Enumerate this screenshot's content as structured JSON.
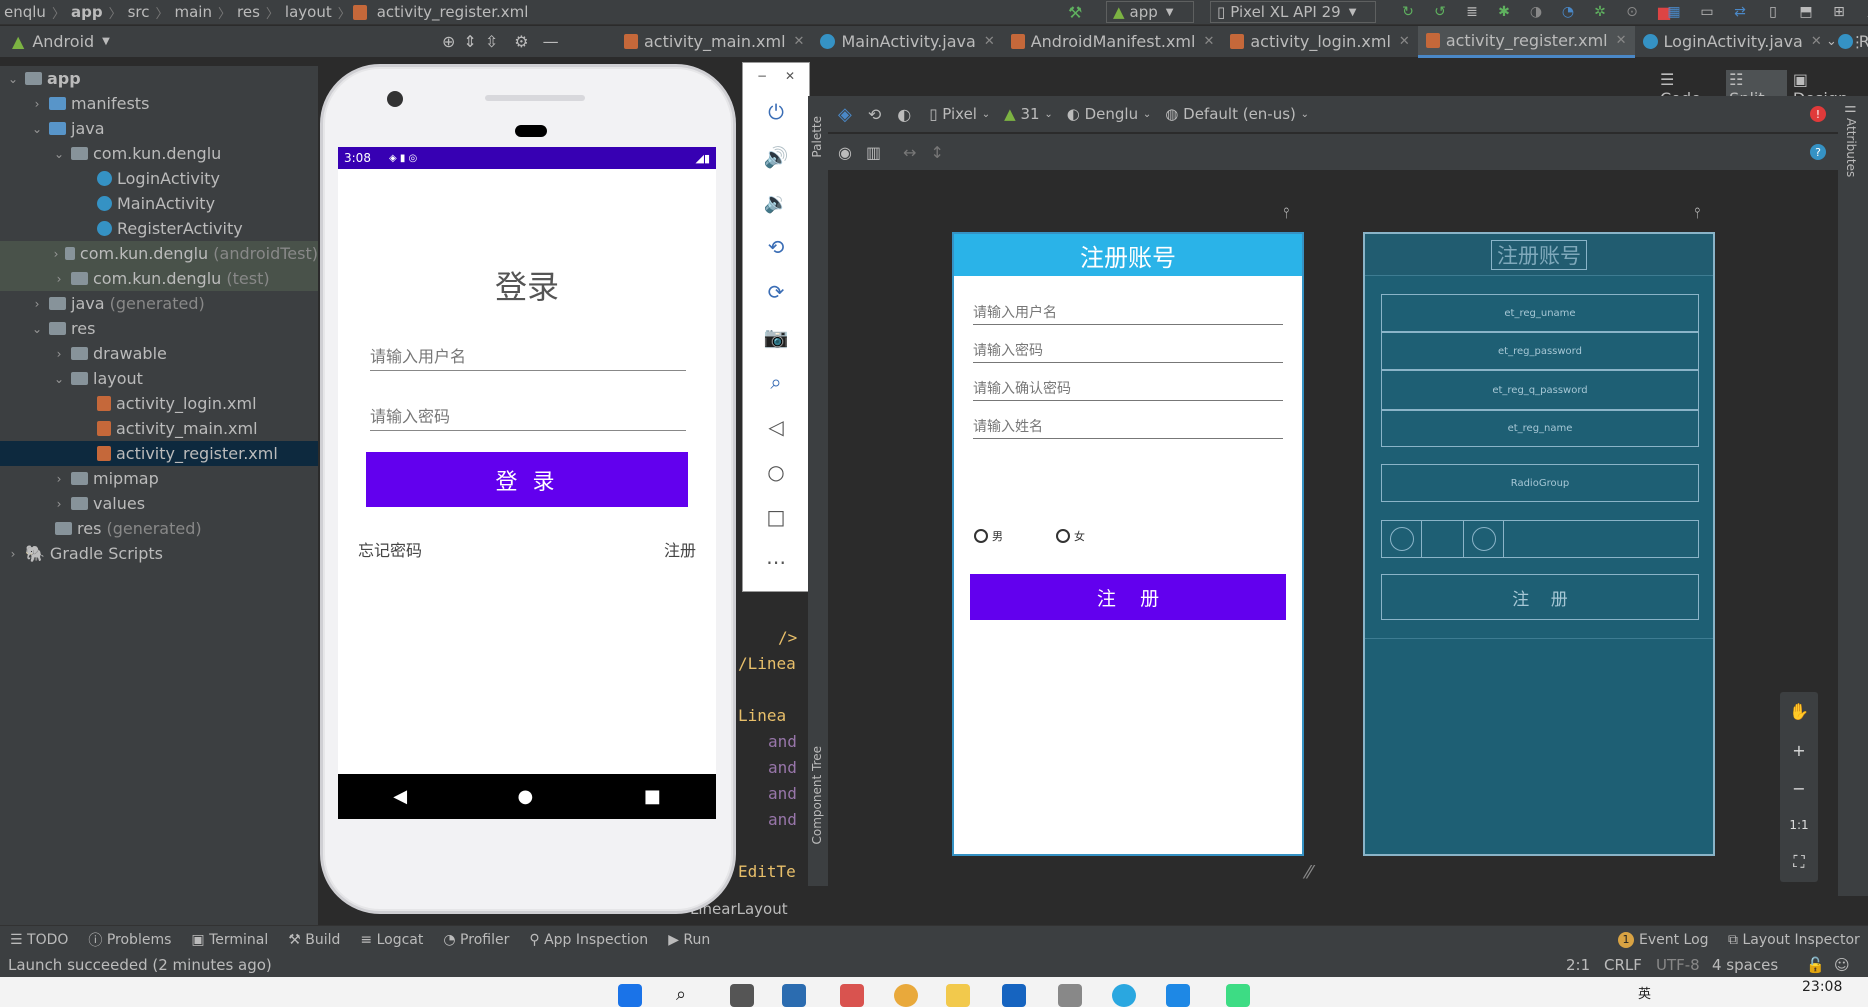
{
  "nav": {
    "breadcrumbs": [
      "enqlu",
      "app",
      "src",
      "main",
      "res",
      "layout",
      "activity_register.xml"
    ],
    "run_config": "app",
    "device": "Pixel XL API 29"
  },
  "tabs": {
    "project_view": "Android",
    "files": [
      {
        "label": "activity_main.xml",
        "type": "xml"
      },
      {
        "label": "MainActivity.java",
        "type": "java"
      },
      {
        "label": "AndroidManifest.xml",
        "type": "xml"
      },
      {
        "label": "activity_login.xml",
        "type": "xml"
      },
      {
        "label": "activity_register.xml",
        "type": "xml"
      },
      {
        "label": "LoginActivity.java",
        "type": "java"
      },
      {
        "label": "R",
        "type": "java"
      }
    ]
  },
  "view_modes": {
    "code": "Code",
    "split": "Split",
    "design": "Design"
  },
  "tree": [
    {
      "label": "app",
      "bold": true
    },
    {
      "label": "manifests"
    },
    {
      "label": "java"
    },
    {
      "label": "com.kun.denglu"
    },
    {
      "label": "LoginActivity"
    },
    {
      "label": "MainActivity"
    },
    {
      "label": "RegisterActivity"
    },
    {
      "label": "com.kun.denglu",
      "suffix": "(androidTest)"
    },
    {
      "label": "com.kun.denglu",
      "suffix": "(test)"
    },
    {
      "label": "java",
      "suffix": "(generated)"
    },
    {
      "label": "res"
    },
    {
      "label": "drawable"
    },
    {
      "label": "layout"
    },
    {
      "label": "activity_login.xml"
    },
    {
      "label": "activity_main.xml"
    },
    {
      "label": "activity_register.xml"
    },
    {
      "label": "mipmap"
    },
    {
      "label": "values"
    },
    {
      "label": "res",
      "suffix": "(generated)"
    },
    {
      "label": "Gradle Scripts"
    }
  ],
  "emulator": {
    "time": "3:08",
    "login_title": "登录",
    "username_hint": "请输入用户名",
    "password_hint": "请输入密码",
    "login_button": "登 录",
    "forgot": "忘记密码",
    "register": "注册"
  },
  "design_toolbar": {
    "device": "Pixel",
    "api": "31",
    "theme": "Denglu",
    "locale": "Default (en-us)",
    "palette": "Palette",
    "component_tree": "Component Tree"
  },
  "preview": {
    "title": "注册账号",
    "hints": [
      "请输入用户名",
      "请输入密码",
      "请输入确认密码",
      "请输入姓名"
    ],
    "radio_male": "男",
    "radio_female": "女",
    "button": "注    册"
  },
  "blueprint": {
    "title": "注册账号",
    "ids": [
      "et_reg_uname",
      "et_reg_password",
      "et_reg_q_password",
      "et_reg_name"
    ],
    "radiogroup": "RadioGroup",
    "button": "注    册"
  },
  "editor_code": [
    "/>",
    "/Linea",
    "Linea",
    "and",
    "and",
    "and",
    "and",
    "EditTe"
  ],
  "editor_breadcrumb": "LinearLayout",
  "attributes_label": "Attributes",
  "zoom": {
    "one_to_one": "1:1"
  },
  "bottom_tools": [
    "TODO",
    "Problems",
    "Terminal",
    "Build",
    "Logcat",
    "Profiler",
    "App Inspection",
    "Run"
  ],
  "right_tools": {
    "event_log": "Event Log",
    "event_count": "1",
    "layout_inspector": "Layout Inspector"
  },
  "status": {
    "message": "Launch succeeded (2 minutes ago)",
    "position": "2:1",
    "line_ending": "CRLF",
    "encoding": "UTF-8",
    "indent": "4 spaces"
  },
  "taskbar": {
    "time": "23:08"
  }
}
